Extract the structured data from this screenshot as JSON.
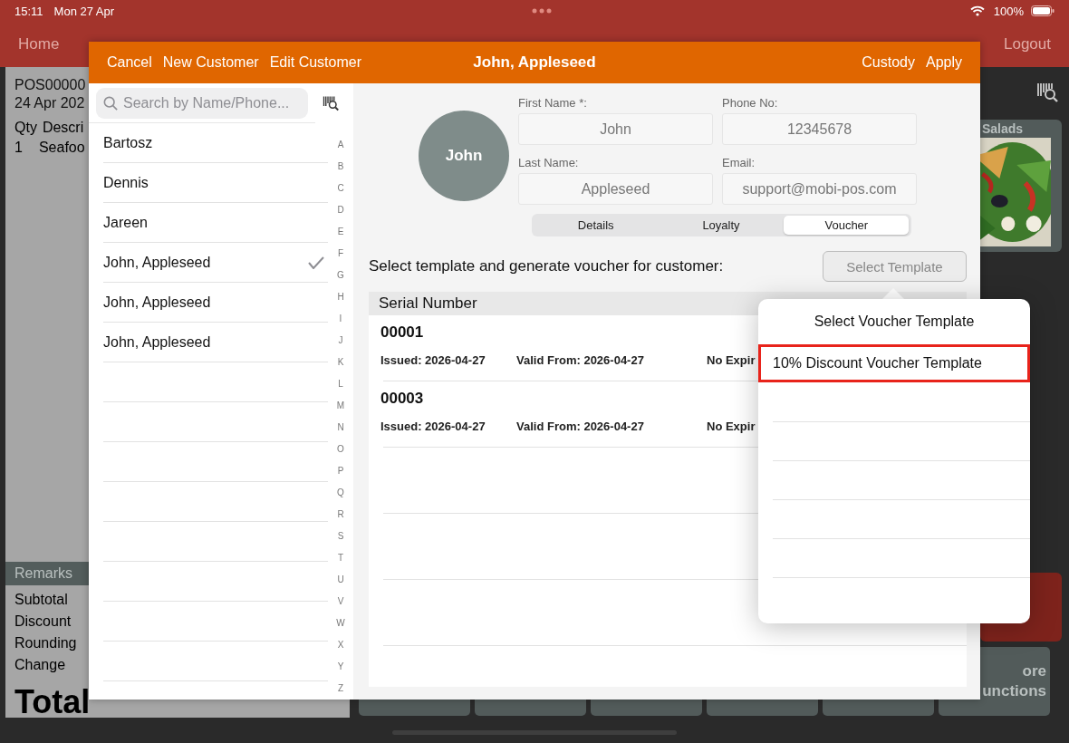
{
  "status_bar": {
    "time": "15:11",
    "date": "Mon 27 Apr",
    "battery": "100%"
  },
  "nav": {
    "left": [
      "Home"
    ],
    "right": [
      "Logout"
    ]
  },
  "order": {
    "number": "POS00000",
    "date": "24 Apr 202",
    "columns": [
      "Qty",
      "Descri"
    ],
    "lines": [
      {
        "qty": "1",
        "description": "Seafoo"
      }
    ],
    "remarks": "Remarks",
    "totals": [
      "Subtotal",
      "Discount",
      "Rounding",
      "Change"
    ],
    "total_label": "Total"
  },
  "categories": [
    {
      "label": "Salads",
      "kind": "picture"
    }
  ],
  "more_button": {
    "lines": [
      "ore",
      "unctions"
    ]
  },
  "modal": {
    "header": {
      "left_actions": [
        "Cancel",
        "New Customer",
        "Edit Customer"
      ],
      "title": "John, Appleseed",
      "right_actions": [
        "Custody",
        "Apply"
      ]
    },
    "search": {
      "placeholder": "Search by Name/Phone..."
    },
    "customers": [
      {
        "name": "Bartosz",
        "selected": false
      },
      {
        "name": "Dennis",
        "selected": false
      },
      {
        "name": "Jareen",
        "selected": false
      },
      {
        "name": "John, Appleseed",
        "selected": true
      },
      {
        "name": "John, Appleseed",
        "selected": false
      },
      {
        "name": "John, Appleseed",
        "selected": false
      }
    ],
    "index_letters": [
      "A",
      "B",
      "C",
      "D",
      "E",
      "F",
      "G",
      "H",
      "I",
      "J",
      "K",
      "L",
      "M",
      "N",
      "O",
      "P",
      "Q",
      "R",
      "S",
      "T",
      "U",
      "V",
      "W",
      "X",
      "Y",
      "Z"
    ],
    "avatar": "John",
    "fields": [
      {
        "label": "First Name *:",
        "value": "John"
      },
      {
        "label": "Phone No:",
        "value": "12345678"
      },
      {
        "label": "Last Name:",
        "value": "Appleseed"
      },
      {
        "label": "Email:",
        "value": "support@mobi-pos.com"
      }
    ],
    "tabs": [
      {
        "label": "Details",
        "selected": false
      },
      {
        "label": "Loyalty",
        "selected": false
      },
      {
        "label": "Voucher",
        "selected": true
      }
    ],
    "prompt": "Select template and generate voucher for customer:",
    "select_button": "Select Template",
    "table": {
      "columns": [
        "Serial Number"
      ],
      "rows": [
        {
          "serial": "00001",
          "issued": "Issued: 2026-04-27",
          "valid_from": "Valid From: 2026-04-27",
          "expiry": "No Expir"
        },
        {
          "serial": "00003",
          "issued": "Issued: 2026-04-27",
          "valid_from": "Valid From: 2026-04-27",
          "expiry": "No Expir"
        }
      ]
    },
    "popover": {
      "title": "Select Voucher Template",
      "items": [
        {
          "label": "10% Discount Voucher Template",
          "selected": true
        }
      ]
    }
  }
}
